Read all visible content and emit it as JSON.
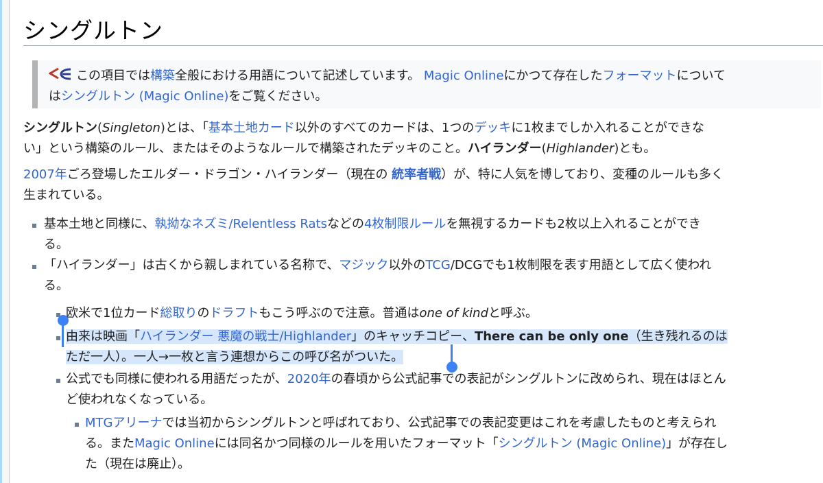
{
  "title": "シングルトン",
  "hatnote": {
    "icon": "wikimedia-disambig-icon",
    "t1": "この項目では",
    "l1": "構築",
    "t2": "全般における用語について記述しています。",
    "l2": "Magic Online",
    "t3": "にかつて存在した",
    "l3": "フォーマット",
    "t4": "について",
    "t5": "は",
    "l4": "シングルトン (Magic Online)",
    "t6": "をご覧ください。"
  },
  "intro": {
    "b1": "シングルトン",
    "t1": "(",
    "i1": "Singleton",
    "t2": ")とは、「",
    "l1": "基本土地カード",
    "t3": "以外のすべてのカードは、1つの",
    "l2": "デッキ",
    "t4": "に1枚までしか入れることができな",
    "t5": "い」という構築のルール、またはそのようなルールで構築されたデッキのこと。",
    "b2": "ハイランダー",
    "t6": "(",
    "i2": "Highlander",
    "t7": ")とも。"
  },
  "p2": {
    "l1": "2007年",
    "t1": "ごろ登場したエルダー・ドラゴン・ハイランダー（現在の ",
    "l2": "統率者戦",
    "t2": "）が、特に人気を博しており、変種のルールも多く",
    "t3": "生まれている。"
  },
  "list": {
    "item1": {
      "t1": "基本土地と同様に、",
      "l1": "執拗なネズミ/Relentless Rats",
      "t2": "などの",
      "l2": "4枚制限ルール",
      "t3": "を無視するカードも2枚以上入れることができ",
      "t4": "る。"
    },
    "item2": {
      "t1": "「ハイランダー」は古くから親しまれている名称で、",
      "l1": "マジック",
      "t2": "以外の",
      "l2": "TCG",
      "t3": "/DCGでも1枚制限を表す用語として広く使われ",
      "t4": "る。"
    },
    "sub1": {
      "t1": "欧米で1位カード",
      "l1": "総取り",
      "t2": "の",
      "l2": "ドラフト",
      "t3": "もこう呼ぶので注意。普通は",
      "i1": "one of kind",
      "t4": "と呼ぶ。"
    },
    "sub2": {
      "t1": "由来は映画「",
      "l1": "ハイランダー 悪魔の戦士/Highlander",
      "t2": "」のキャッチコピー、",
      "b1": "There can be only one",
      "t3": "（生き残れるのは",
      "t4": "ただ一人）。一人→一枚と言う連想からこの呼び名がついた。"
    },
    "sub3": {
      "t1": "公式でも同様に使われる用語だったが、",
      "l1": "2020年",
      "t2": "の春頃から公式記事での表記がシングルトンに改められ、現在はほとん",
      "t3": "ど使われなくなっている。"
    },
    "subsub1": {
      "l1": "MTGアリーナ",
      "t1": "では当初からシングルトンと呼ばれており、公式記事での表記変更はこれを考慮したものと考えられ",
      "t2": "る。また",
      "l2": "Magic Online",
      "t3": "には同名かつ同様のルールを用いたフォーマット「",
      "l3": "シングルトン (Magic Online)",
      "t4": "」が存在し",
      "t5": "た（現在は廃止）。"
    }
  },
  "colors": {
    "link": "#3366cc",
    "selection": "#d6e6fb",
    "handle": "#3b82f6"
  }
}
